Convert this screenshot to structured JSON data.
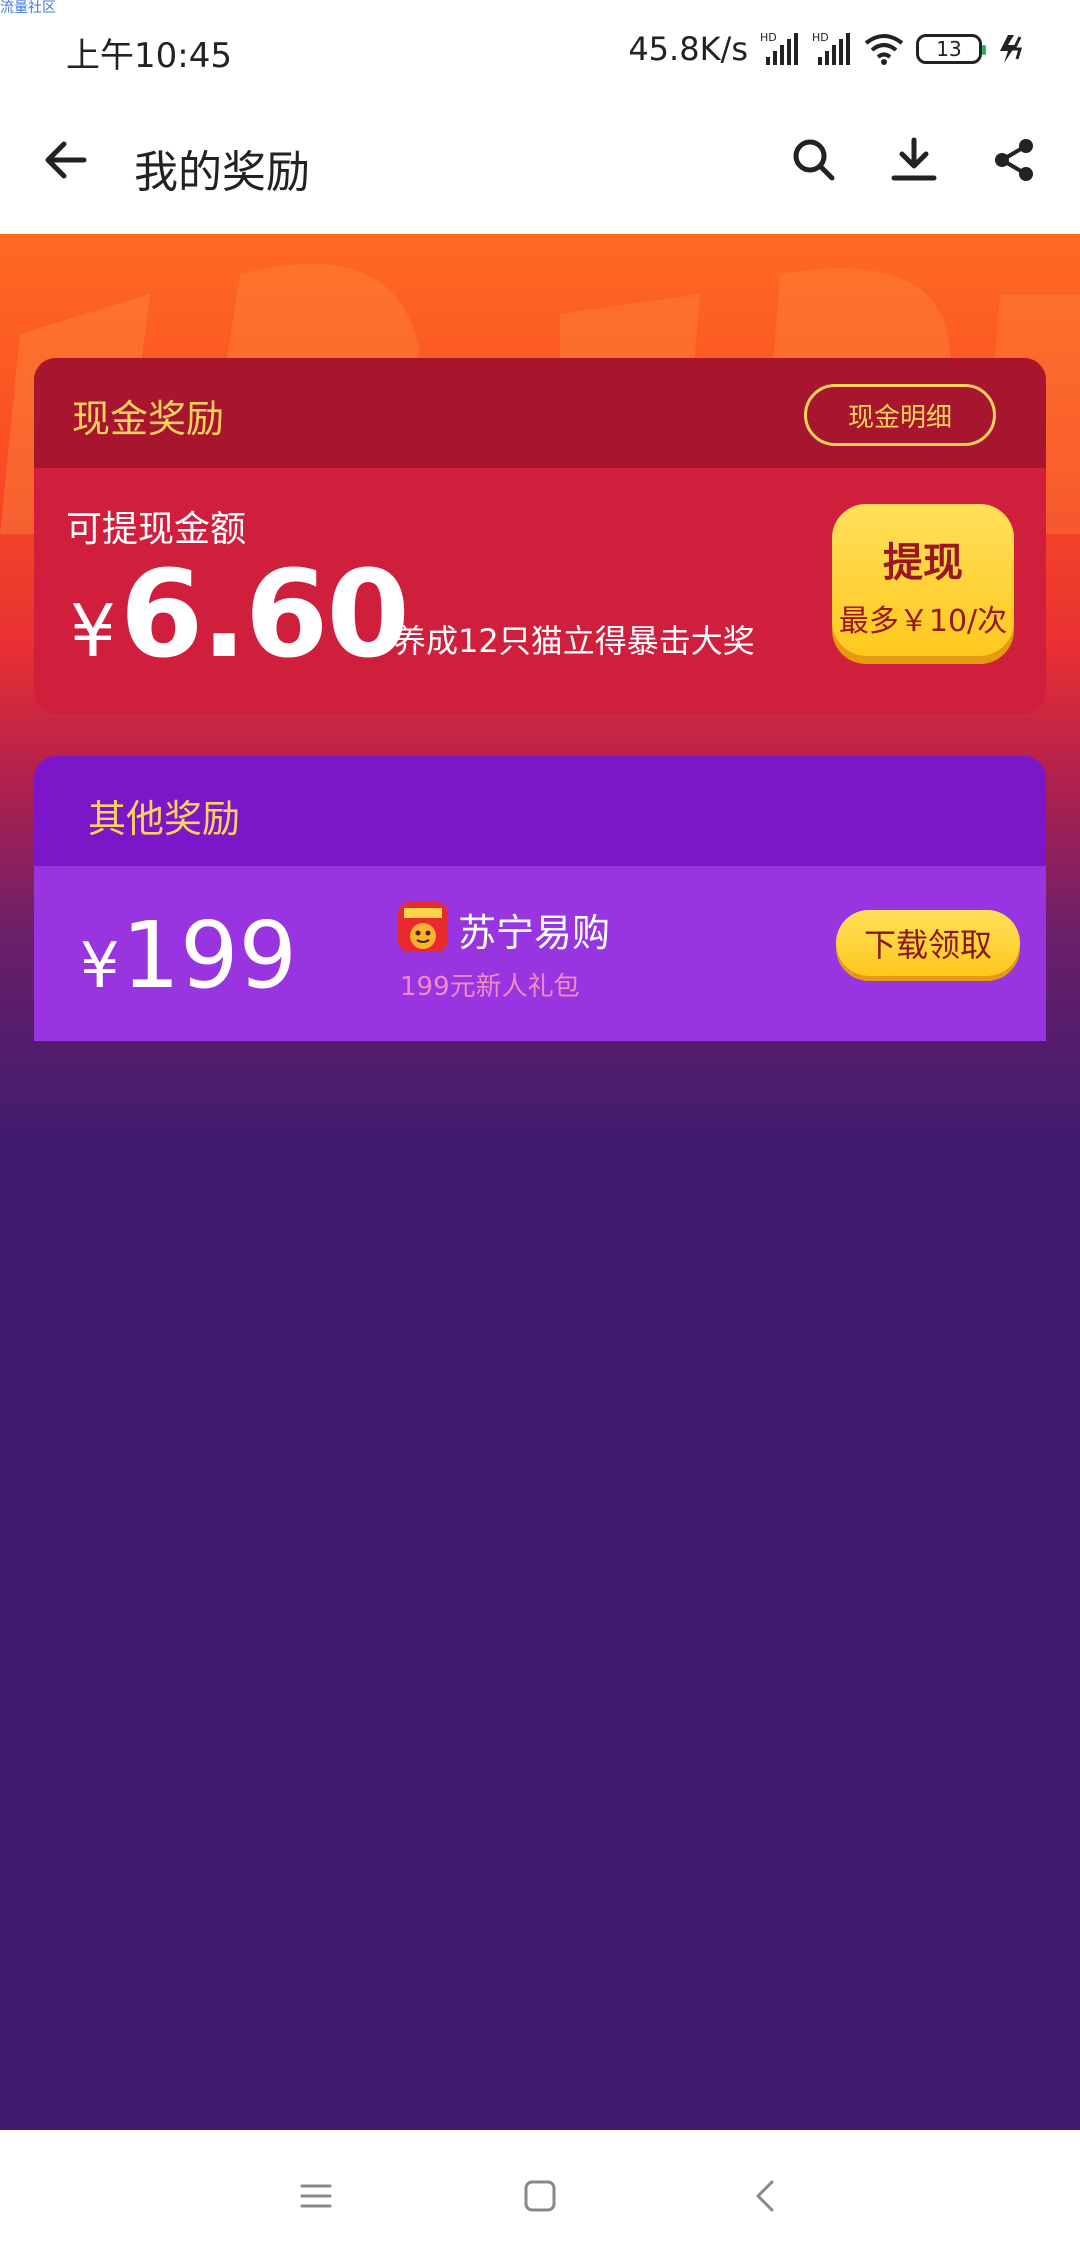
{
  "watermark": "流量社区",
  "status_bar": {
    "time": "上午10:45",
    "net_speed": "45.8K/s",
    "signal1_label": "HD",
    "signal2_label": "HD",
    "battery": "13"
  },
  "header": {
    "title": "我的奖励",
    "icons": [
      "back-arrow-icon",
      "search-icon",
      "download-icon",
      "share-icon"
    ]
  },
  "cash_card": {
    "title": "现金奖励",
    "detail_button": "现金明细",
    "available_label": "可提现金额",
    "currency_symbol": "¥",
    "amount": "6.60",
    "hint": "养成12只猫立得暴击大奖",
    "withdraw_button": "提现",
    "withdraw_limit": "最多￥10/次"
  },
  "other_card": {
    "title": "其他奖励",
    "currency_symbol": "¥",
    "amount": "199",
    "app_name": "苏宁易购",
    "app_subtitle": "199元新人礼包",
    "claim_button": "下载领取"
  },
  "colors": {
    "accent_yellow": "#fcd35a",
    "cash_card_red": "#d01f3d",
    "other_card_purple": "#9935e0",
    "page_purple": "#421b6e"
  },
  "nav_bar": {
    "icons": [
      "menu-icon",
      "home-square-icon",
      "back-chevron-icon"
    ]
  }
}
